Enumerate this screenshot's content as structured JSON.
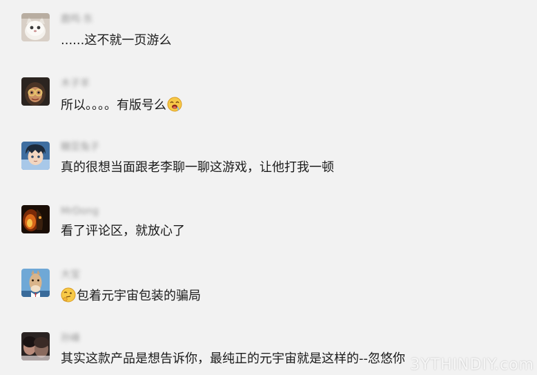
{
  "comments": [
    {
      "username": "鹿鸣·东",
      "text": "......这不就一页游么",
      "avatar_icon": "cat-avatar",
      "emoji": ""
    },
    {
      "username": "木子羊",
      "text": "所以。。。。有版号么",
      "avatar_icon": "girl-with-mask-avatar",
      "emoji": "drooling-emoji"
    },
    {
      "username": "糖豆兔子",
      "text": "真的很想当面跟老李聊一聊这游戏，让他打我一顿",
      "avatar_icon": "anime-boy-avatar",
      "emoji": ""
    },
    {
      "username": "MrDong",
      "text": "看了评论区，就放心了",
      "avatar_icon": "fire-creature-avatar",
      "emoji": ""
    },
    {
      "username": "大宝ㅤ",
      "text": "包着元宇宙包装的骗局",
      "avatar_icon": "horse-avatar",
      "emoji": "thinking-emoji"
    },
    {
      "username": "孙峰",
      "text": "其实这款产品是想告诉你，最纯正的元宇宙就是这样的--忽悠你",
      "avatar_icon": "dark-photo-avatar",
      "emoji": ""
    }
  ],
  "watermark": "3YTHINDIY.com"
}
